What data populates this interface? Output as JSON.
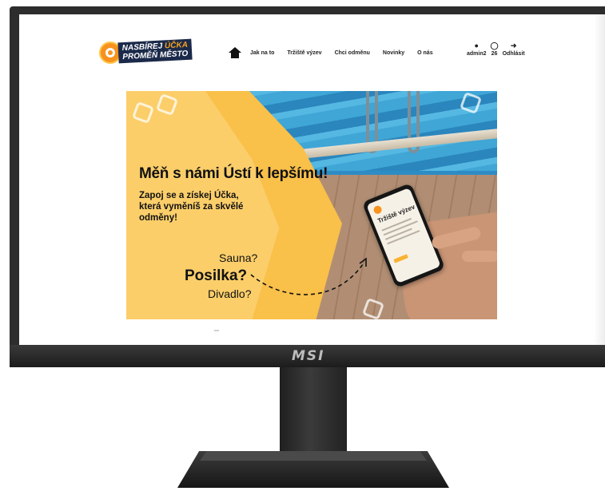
{
  "monitor": {
    "brand": "MSI"
  },
  "site": {
    "logo": {
      "line1a": "NASBÍREJ ",
      "line1b": "ÚČKA",
      "line2": "PROMĚŇ MĚSTO"
    },
    "nav": [
      {
        "label": "Jak na to"
      },
      {
        "label": "Tržiště výzev"
      },
      {
        "label": "Chci odměnu"
      },
      {
        "label": "Novinky"
      },
      {
        "label": "O nás"
      }
    ],
    "user": {
      "username": "admin2",
      "points": "26",
      "logout": "Odhlásit",
      "icons": [
        "user-icon",
        "award-icon",
        "logout-icon"
      ]
    }
  },
  "hero": {
    "headline": "Měň s námi Ústí k lepšímu!",
    "subtitle": "Zapoj se a získej Účka, která vyměníš za skvělé odměny!",
    "questions": [
      "Sauna?",
      "Posilka?",
      "Divadlo?"
    ],
    "phone_title": "Tržiště výzev"
  },
  "colors": {
    "accent": "#f9b233",
    "hero_yellow": "#f9c04a",
    "logo_navy": "#1b2a4a",
    "logo_orange": "#f7921e"
  }
}
